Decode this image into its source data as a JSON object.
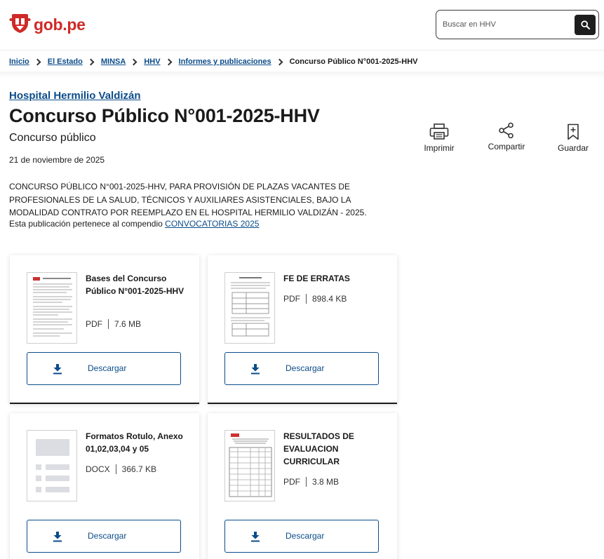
{
  "header": {
    "logo_text": "gob.pe",
    "search_placeholder": "Buscar en HHV"
  },
  "breadcrumb": {
    "items": [
      "Inicio",
      "El Estado",
      "MINSA",
      "HHV",
      "Informes y publicaciones"
    ],
    "current": "Concurso Público N°001-2025-HHV"
  },
  "page": {
    "institution": "Hospital Hermilio Valdizán",
    "title": "Concurso Público N°001-2025-HHV",
    "subtitle": "Concurso público",
    "date": "21 de noviembre de 2025",
    "description": "CONCURSO PÚBLICO N°001-2025-HHV, PARA PROVISIÓN DE PLAZAS VACANTES DE PROFESIONALES DE LA SALUD, TÉCNICOS Y AUXILIARES ASISTENCIALES, BAJO LA MODALIDAD CONTRATO POR REEMPLAZO EN EL HOSPITAL HERMILIO VALDIZÁN - 2025.",
    "compendium_prefix": "Esta publicación pertenece al compendio",
    "compendium_link": "CONVOCATORIAS 2025"
  },
  "actions": {
    "print": "Imprimir",
    "share": "Compartir",
    "save": "Guardar"
  },
  "documents": [
    {
      "title": "Bases del Concurso Público N°001-2025-HHV",
      "type": "PDF",
      "size": "7.6 MB",
      "button": "Descargar",
      "thumb": "document-preview"
    },
    {
      "title": "FE DE ERRATAS",
      "type": "PDF",
      "size": "898.4 KB",
      "button": "Descargar",
      "thumb": "document-preview"
    },
    {
      "title": "Formatos Rotulo, Anexo 01,02,03,04 y 05",
      "type": "DOCX",
      "size": "366.7 KB",
      "button": "Descargar",
      "thumb": "generic-file-icon"
    },
    {
      "title": "RESULTADOS DE EVALUACION CURRICULAR",
      "type": "PDF",
      "size": "3.8 MB",
      "button": "Descargar",
      "thumb": "table-document-preview"
    }
  ],
  "colors": {
    "brand_red": "#cf2a27",
    "link_blue": "#0b4c8a",
    "text": "#1a1a1a"
  }
}
